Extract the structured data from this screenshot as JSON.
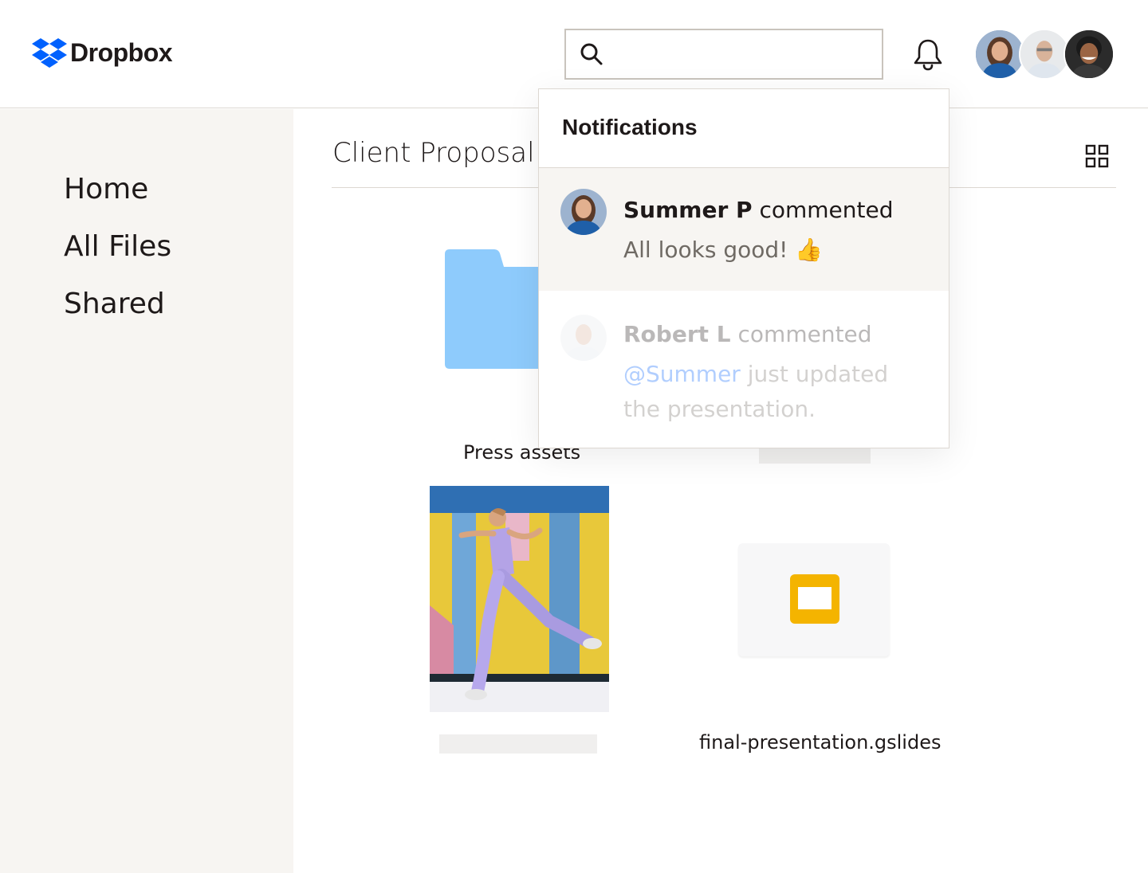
{
  "brand": {
    "name": "Dropbox",
    "color": "#0061fe"
  },
  "search": {
    "value": "",
    "placeholder": ""
  },
  "header": {
    "avatars": [
      "Summer P",
      "Robert L",
      "Collaborator"
    ]
  },
  "sidebar": {
    "items": [
      {
        "label": "Home"
      },
      {
        "label": "All Files"
      },
      {
        "label": "Shared"
      }
    ]
  },
  "main": {
    "title": "Client Proposal",
    "items": [
      {
        "type": "folder",
        "label": "Press assets",
        "color": "#8ecbfc"
      },
      {
        "type": "image",
        "label": ""
      },
      {
        "type": "gslides",
        "label": "final-presentation.gslides",
        "color": "#f4b400"
      }
    ]
  },
  "notifications": {
    "title": "Notifications",
    "items": [
      {
        "author": "Summer P",
        "action": "commented",
        "message": "All looks good! 👍"
      },
      {
        "author": "Robert L",
        "action": "commented",
        "mention": "@Summer",
        "message_rest": "just updated",
        "message_line2": "the presentation."
      }
    ]
  },
  "icons": [
    "dropbox-logo-icon",
    "search-icon",
    "bell-icon",
    "grid-view-icon",
    "folder-icon",
    "slides-icon"
  ]
}
